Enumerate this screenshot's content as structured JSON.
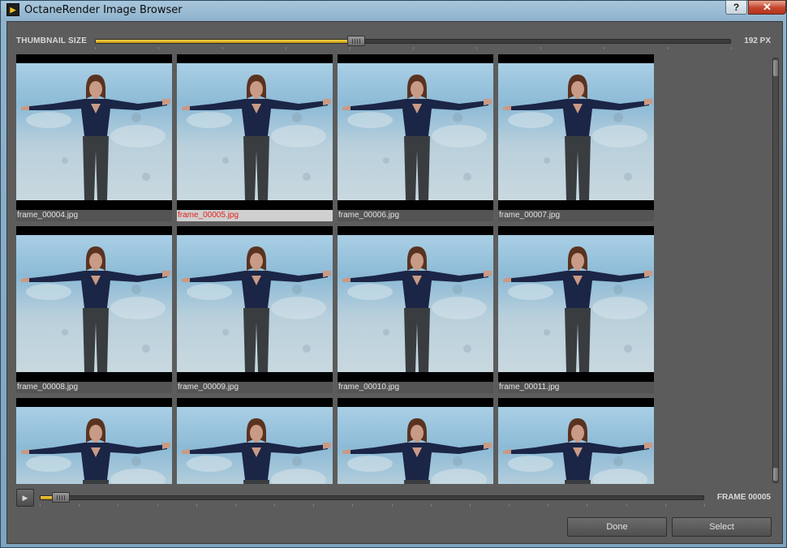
{
  "window": {
    "title": "OctaneRender Image Browser",
    "help_label": "?",
    "close_label": "✕",
    "app_icon": "octane-play-icon"
  },
  "thumbnail_size": {
    "label": "THUMBNAIL SIZE",
    "value_text": "192 PX",
    "level_fraction": 0.41,
    "accent": "#e8b923"
  },
  "thumbnails": [
    {
      "name": "frame_00004.jpg",
      "selected": false
    },
    {
      "name": "frame_00005.jpg",
      "selected": true
    },
    {
      "name": "frame_00006.jpg",
      "selected": false
    },
    {
      "name": "frame_00007.jpg",
      "selected": false
    },
    {
      "name": "frame_00008.jpg",
      "selected": false
    },
    {
      "name": "frame_00009.jpg",
      "selected": false
    },
    {
      "name": "frame_00010.jpg",
      "selected": false
    },
    {
      "name": "frame_00011.jpg",
      "selected": false
    },
    {
      "name": "",
      "selected": false
    },
    {
      "name": "",
      "selected": false
    },
    {
      "name": "",
      "selected": false
    },
    {
      "name": "",
      "selected": false
    }
  ],
  "frame": {
    "play_label": "▶",
    "value_text": "FRAME 00005",
    "level_fraction": 0.03
  },
  "buttons": {
    "done": "Done",
    "select": "Select"
  },
  "colors": {
    "selected_caption_text": "#e0201a",
    "panel_background": "#5c5c5c"
  }
}
